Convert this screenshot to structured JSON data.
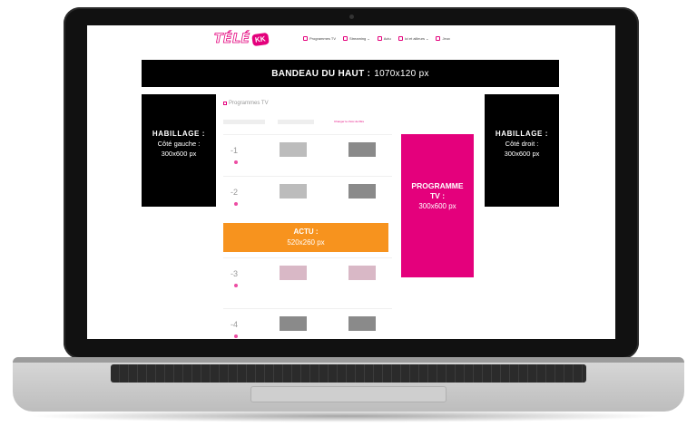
{
  "header": {
    "logo_text": "TÉLÉ",
    "logo_badge": "KK",
    "nav": [
      {
        "label": "Programmes TV",
        "icon": "tv-icon"
      },
      {
        "label": "Streaming ⌄",
        "icon": "streaming-icon"
      },
      {
        "label": "Actu",
        "icon": "news-icon"
      },
      {
        "label": "Ici et ailleurs ⌄",
        "icon": "globe-icon"
      },
      {
        "label": "Jeux",
        "icon": "games-icon"
      }
    ]
  },
  "ads": {
    "banner": {
      "title": "BANDEAU DU HAUT :",
      "size": "1070x120 px"
    },
    "left": {
      "title": "HABILLAGE :",
      "line1": "Côté gauche :",
      "size": "300x600 px"
    },
    "right": {
      "title": "HABILLAGE :",
      "line1": "Côté droit :",
      "size": "300x600 px"
    },
    "programme": {
      "title1": "PROGRAMME",
      "title2": "TV :",
      "size": "300x600 px"
    },
    "actu": {
      "title": "ACTU :",
      "size": "520x260 px"
    }
  },
  "programmes": {
    "title": "Programmes TV",
    "filter_link": "Changer le choix de filtre",
    "rows": [
      {
        "rank": "-1"
      },
      {
        "rank": "-2"
      },
      {
        "rank": "-3"
      },
      {
        "rank": "-4"
      }
    ]
  }
}
